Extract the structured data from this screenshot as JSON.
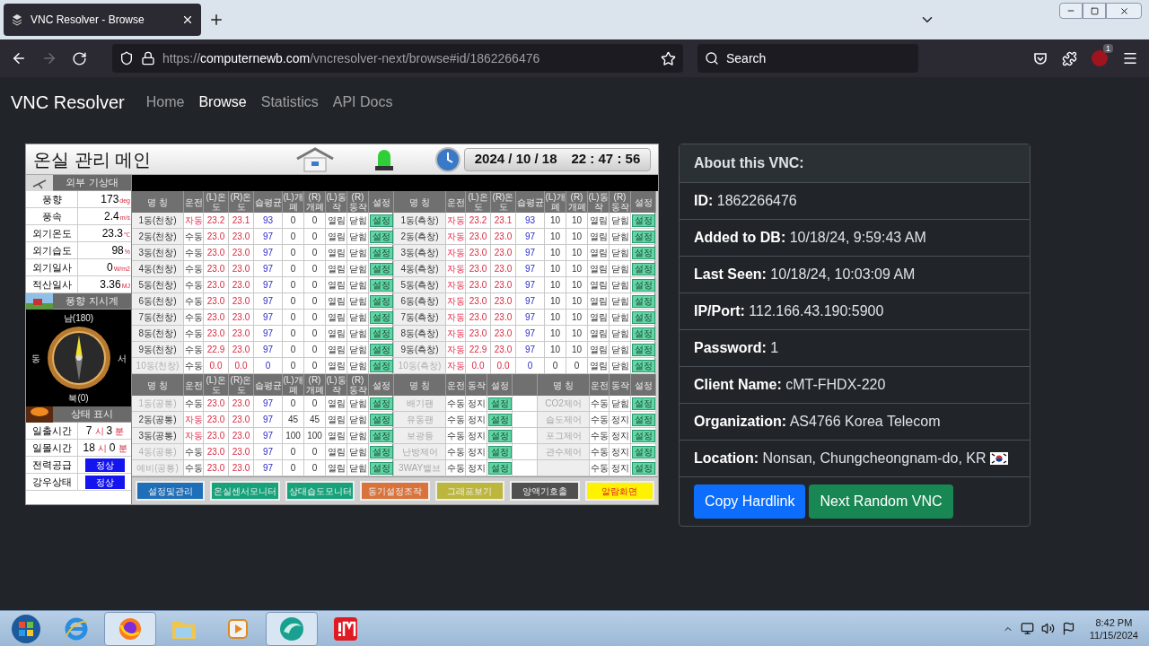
{
  "browser": {
    "tab": {
      "title": "VNC Resolver - Browse"
    },
    "forward_disabled": true,
    "url": {
      "prefix": "https://",
      "domain": "computernewb.com",
      "path": "/vncresolver-next/browse#id/1862266476"
    },
    "search": {
      "placeholder": "Search"
    },
    "badge": "1"
  },
  "nav": {
    "brand": "VNC Resolver",
    "links": [
      {
        "label": "Home",
        "selected": false
      },
      {
        "label": "Browse",
        "selected": true
      },
      {
        "label": "Statistics",
        "selected": false
      },
      {
        "label": "API Docs",
        "selected": false
      }
    ]
  },
  "hmi": {
    "title": "온실 관리 메인",
    "date": "2024 / 10 / 18",
    "time": "22 : 47 : 56",
    "weather": {
      "header": "외부 기상대",
      "rows": [
        {
          "label": "풍향",
          "value": "173",
          "unit": "deg"
        },
        {
          "label": "풍속",
          "value": "2.4",
          "unit": "m/s"
        },
        {
          "label": "외기온도",
          "value": "23.3",
          "unit": "℃"
        },
        {
          "label": "외기습도",
          "value": "98",
          "unit": "%"
        },
        {
          "label": "외기일사",
          "value": "0",
          "unit": "W/m2"
        },
        {
          "label": "적산일사",
          "value": "3.36",
          "unit": "MJ"
        }
      ]
    },
    "compass": {
      "header": "풍향 지시계",
      "south": "남(180)",
      "east": "동",
      "west": "서",
      "north": "북(0)"
    },
    "status": {
      "header": "상태 표시",
      "sun": [
        {
          "label": "일출시간",
          "hour": "7",
          "hour_unit": "시",
          "minute": "3",
          "minute_unit": "분"
        },
        {
          "label": "일몰시간",
          "hour": "18",
          "hour_unit": "시",
          "minute": "0",
          "minute_unit": "분"
        }
      ],
      "flags": [
        {
          "label": "전력공급",
          "value": "정상"
        },
        {
          "label": "강우상태",
          "value": "정상"
        }
      ]
    },
    "top": [
      {
        "columns": [
          "명 칭",
          "운전",
          "(L)온도",
          "(R)온도",
          "습평균",
          "(L)개폐",
          "(R)개폐",
          "(L)동작",
          "(R)동작",
          "설정"
        ],
        "rows": [
          {
            "name": "1동(천창)",
            "disabled": false,
            "mode": "자동",
            "auto": true,
            "values": [
              "23.2",
              "23.1",
              "93",
              "0",
              "0",
              "열림",
              "닫힘"
            ],
            "setting": "설정"
          },
          {
            "name": "2동(천창)",
            "disabled": false,
            "mode": "수동",
            "auto": false,
            "values": [
              "23.0",
              "23.0",
              "97",
              "0",
              "0",
              "열림",
              "닫힘"
            ],
            "setting": "설정"
          },
          {
            "name": "3동(천창)",
            "disabled": false,
            "mode": "수동",
            "auto": false,
            "values": [
              "23.0",
              "23.0",
              "97",
              "0",
              "0",
              "열림",
              "닫힘"
            ],
            "setting": "설정"
          },
          {
            "name": "4동(천창)",
            "disabled": false,
            "mode": "수동",
            "auto": false,
            "values": [
              "23.0",
              "23.0",
              "97",
              "0",
              "0",
              "열림",
              "닫힘"
            ],
            "setting": "설정"
          },
          {
            "name": "5동(천창)",
            "disabled": false,
            "mode": "수동",
            "auto": false,
            "values": [
              "23.0",
              "23.0",
              "97",
              "0",
              "0",
              "열림",
              "닫힘"
            ],
            "setting": "설정"
          },
          {
            "name": "6동(천창)",
            "disabled": false,
            "mode": "수동",
            "auto": false,
            "values": [
              "23.0",
              "23.0",
              "97",
              "0",
              "0",
              "열림",
              "닫힘"
            ],
            "setting": "설정"
          },
          {
            "name": "7동(천창)",
            "disabled": false,
            "mode": "수동",
            "auto": false,
            "values": [
              "23.0",
              "23.0",
              "97",
              "0",
              "0",
              "열림",
              "닫힘"
            ],
            "setting": "설정"
          },
          {
            "name": "8동(천창)",
            "disabled": false,
            "mode": "수동",
            "auto": false,
            "values": [
              "23.0",
              "23.0",
              "97",
              "0",
              "0",
              "열림",
              "닫힘"
            ],
            "setting": "설정"
          },
          {
            "name": "9동(천창)",
            "disabled": false,
            "mode": "수동",
            "auto": false,
            "values": [
              "22.9",
              "23.0",
              "97",
              "0",
              "0",
              "열림",
              "닫힘"
            ],
            "setting": "설정"
          },
          {
            "name": "10동(천창)",
            "disabled": true,
            "mode": "수동",
            "auto": false,
            "values": [
              "0.0",
              "0.0",
              "0",
              "0",
              "0",
              "열림",
              "닫힘"
            ],
            "setting": "설정"
          }
        ]
      },
      {
        "columns": [
          "명 칭",
          "운전",
          "(L)온도",
          "(R)온도",
          "습평균",
          "(L)개폐",
          "(R)개폐",
          "(L)동작",
          "(R)동작",
          "설정"
        ],
        "rows": [
          {
            "name": "1동(측창)",
            "disabled": false,
            "mode": "자동",
            "auto": true,
            "values": [
              "23.2",
              "23.1",
              "93",
              "10",
              "10",
              "열림",
              "닫힘"
            ],
            "setting": "설정"
          },
          {
            "name": "2동(측창)",
            "disabled": false,
            "mode": "자동",
            "auto": true,
            "values": [
              "23.0",
              "23.0",
              "97",
              "10",
              "10",
              "열림",
              "닫힘"
            ],
            "setting": "설정"
          },
          {
            "name": "3동(측창)",
            "disabled": false,
            "mode": "자동",
            "auto": true,
            "values": [
              "23.0",
              "23.0",
              "97",
              "10",
              "10",
              "열림",
              "닫힘"
            ],
            "setting": "설정"
          },
          {
            "name": "4동(측창)",
            "disabled": false,
            "mode": "자동",
            "auto": true,
            "values": [
              "23.0",
              "23.0",
              "97",
              "10",
              "10",
              "열림",
              "닫힘"
            ],
            "setting": "설정"
          },
          {
            "name": "5동(측창)",
            "disabled": false,
            "mode": "자동",
            "auto": true,
            "values": [
              "23.0",
              "23.0",
              "97",
              "10",
              "10",
              "열림",
              "닫힘"
            ],
            "setting": "설정"
          },
          {
            "name": "6동(측창)",
            "disabled": false,
            "mode": "자동",
            "auto": true,
            "values": [
              "23.0",
              "23.0",
              "97",
              "10",
              "10",
              "열림",
              "닫힘"
            ],
            "setting": "설정"
          },
          {
            "name": "7동(측창)",
            "disabled": false,
            "mode": "자동",
            "auto": true,
            "values": [
              "23.0",
              "23.0",
              "97",
              "10",
              "10",
              "열림",
              "닫힘"
            ],
            "setting": "설정"
          },
          {
            "name": "8동(측창)",
            "disabled": false,
            "mode": "자동",
            "auto": true,
            "values": [
              "23.0",
              "23.0",
              "97",
              "10",
              "10",
              "열림",
              "닫힘"
            ],
            "setting": "설정"
          },
          {
            "name": "9동(측창)",
            "disabled": false,
            "mode": "자동",
            "auto": true,
            "values": [
              "22.9",
              "23.0",
              "97",
              "10",
              "10",
              "열림",
              "닫힘"
            ],
            "setting": "설정"
          },
          {
            "name": "10동(측창)",
            "disabled": true,
            "mode": "자동",
            "auto": true,
            "values": [
              "0.0",
              "0.0",
              "0",
              "0",
              "0",
              "열림",
              "닫힘"
            ],
            "setting": "설정"
          }
        ]
      }
    ],
    "bottom": {
      "columns": [
        "명 칭",
        "운전",
        "(L)온도",
        "(R)온도",
        "습평균",
        "(L)개폐",
        "(R)개폐",
        "(L)동작",
        "(R)동작",
        "설정"
      ],
      "rows": [
        {
          "name": "1동(공통)",
          "disabled": true,
          "mode": "수동",
          "auto": false,
          "values": [
            "23.0",
            "23.0",
            "97",
            "0",
            "0",
            "열림",
            "닫힘"
          ],
          "setting": "설정"
        },
        {
          "name": "2동(공통)",
          "disabled": false,
          "mode": "자동",
          "auto": true,
          "values": [
            "23.0",
            "23.0",
            "97",
            "45",
            "45",
            "열림",
            "닫힘"
          ],
          "setting": "설정"
        },
        {
          "name": "3동(공통)",
          "disabled": false,
          "mode": "자동",
          "auto": true,
          "values": [
            "23.0",
            "23.0",
            "97",
            "100",
            "100",
            "열림",
            "닫힘"
          ],
          "setting": "설정"
        },
        {
          "name": "4동(공통)",
          "disabled": true,
          "mode": "수동",
          "auto": false,
          "values": [
            "23.0",
            "23.0",
            "97",
            "0",
            "0",
            "열림",
            "닫힘"
          ],
          "setting": "설정"
        },
        {
          "name": "예비(공통)",
          "disabled": true,
          "mode": "수동",
          "auto": false,
          "values": [
            "23.0",
            "23.0",
            "97",
            "0",
            "0",
            "열림",
            "닫힘"
          ],
          "setting": "설정"
        }
      ]
    },
    "devices": [
      {
        "columns": [
          "명 칭",
          "운전",
          "동작",
          "설정"
        ],
        "rows": [
          {
            "name": "배기팬",
            "mode": "수동",
            "action": "정지",
            "setting": "설정"
          },
          {
            "name": "유동팬",
            "mode": "수동",
            "action": "정지",
            "setting": "설정"
          },
          {
            "name": "보광등",
            "mode": "수동",
            "action": "정지",
            "setting": "설정"
          },
          {
            "name": "난방제어",
            "mode": "수동",
            "action": "정지",
            "setting": "설정"
          },
          {
            "name": "3WAY밸브",
            "mode": "수동",
            "action": "정지",
            "setting": "설정"
          }
        ]
      },
      {
        "columns": [
          "명 칭",
          "운전",
          "동작",
          "설정"
        ],
        "rows": [
          {
            "name": "CO2제어",
            "mode": "수동",
            "action": "닫힘",
            "setting": "설정"
          },
          {
            "name": "습도제어",
            "mode": "수동",
            "action": "정지",
            "setting": "설정"
          },
          {
            "name": "포그제어",
            "mode": "수동",
            "action": "정지",
            "setting": "설정"
          },
          {
            "name": "관수제어",
            "mode": "수동",
            "action": "정지",
            "setting": "설정"
          },
          {
            "mode": "수동",
            "action": "정지",
            "setting": "설정"
          }
        ]
      }
    ],
    "buttons": [
      {
        "label": "설정및관리",
        "color": "#1f6fb8",
        "kind": "normal"
      },
      {
        "label": "온실센서모니터",
        "color": "#17a27a",
        "kind": "normal"
      },
      {
        "label": "상대습도모니터",
        "color": "#17a27a",
        "kind": "normal"
      },
      {
        "label": "동기설정조작",
        "color": "#d8733c",
        "kind": "normal"
      },
      {
        "label": "그래프보기",
        "color": "#bcb63c",
        "kind": "normal"
      },
      {
        "label": "양액기호출",
        "color": "#505050",
        "kind": "normal"
      },
      {
        "label": "알람화면",
        "color": "#fff200",
        "kind": "alarm"
      }
    ]
  },
  "card": {
    "title": "About this VNC:",
    "rows": [
      {
        "kind": "field",
        "text": "**ID:** 1862266476"
      },
      {
        "kind": "field",
        "text": "**Added to DB:** 10/18/24, 9:59:43 AM"
      },
      {
        "kind": "field",
        "text": "**Last Seen:** 10/18/24, 10:03:09 AM"
      },
      {
        "kind": "field",
        "text": "**IP/Port:** 112.166.43.190:5900"
      },
      {
        "kind": "field",
        "text": "**Password:** 1"
      },
      {
        "kind": "field",
        "text": "**Client Name:** cMT-FHDX-220"
      },
      {
        "kind": "field",
        "text": "**Organization:** AS4766 Korea Telecom"
      },
      {
        "kind": "location",
        "text": "**Location:** Nonsan, Chungcheongnam-do, KR"
      }
    ],
    "buttons": [
      {
        "label": "Copy Hardlink",
        "color": "#0d6efd"
      },
      {
        "label": "Next Random VNC",
        "color": "#198754"
      }
    ]
  },
  "taskbar": {
    "apps": [
      {
        "kind": "ie",
        "selected": false
      },
      {
        "kind": "firefox",
        "selected": true
      },
      {
        "kind": "folder",
        "selected": false
      },
      {
        "kind": "media",
        "selected": false
      },
      {
        "kind": "orb",
        "selected": true
      },
      {
        "kind": "red",
        "selected": false
      }
    ],
    "time": "8:42 PM",
    "date": "11/15/2024"
  }
}
